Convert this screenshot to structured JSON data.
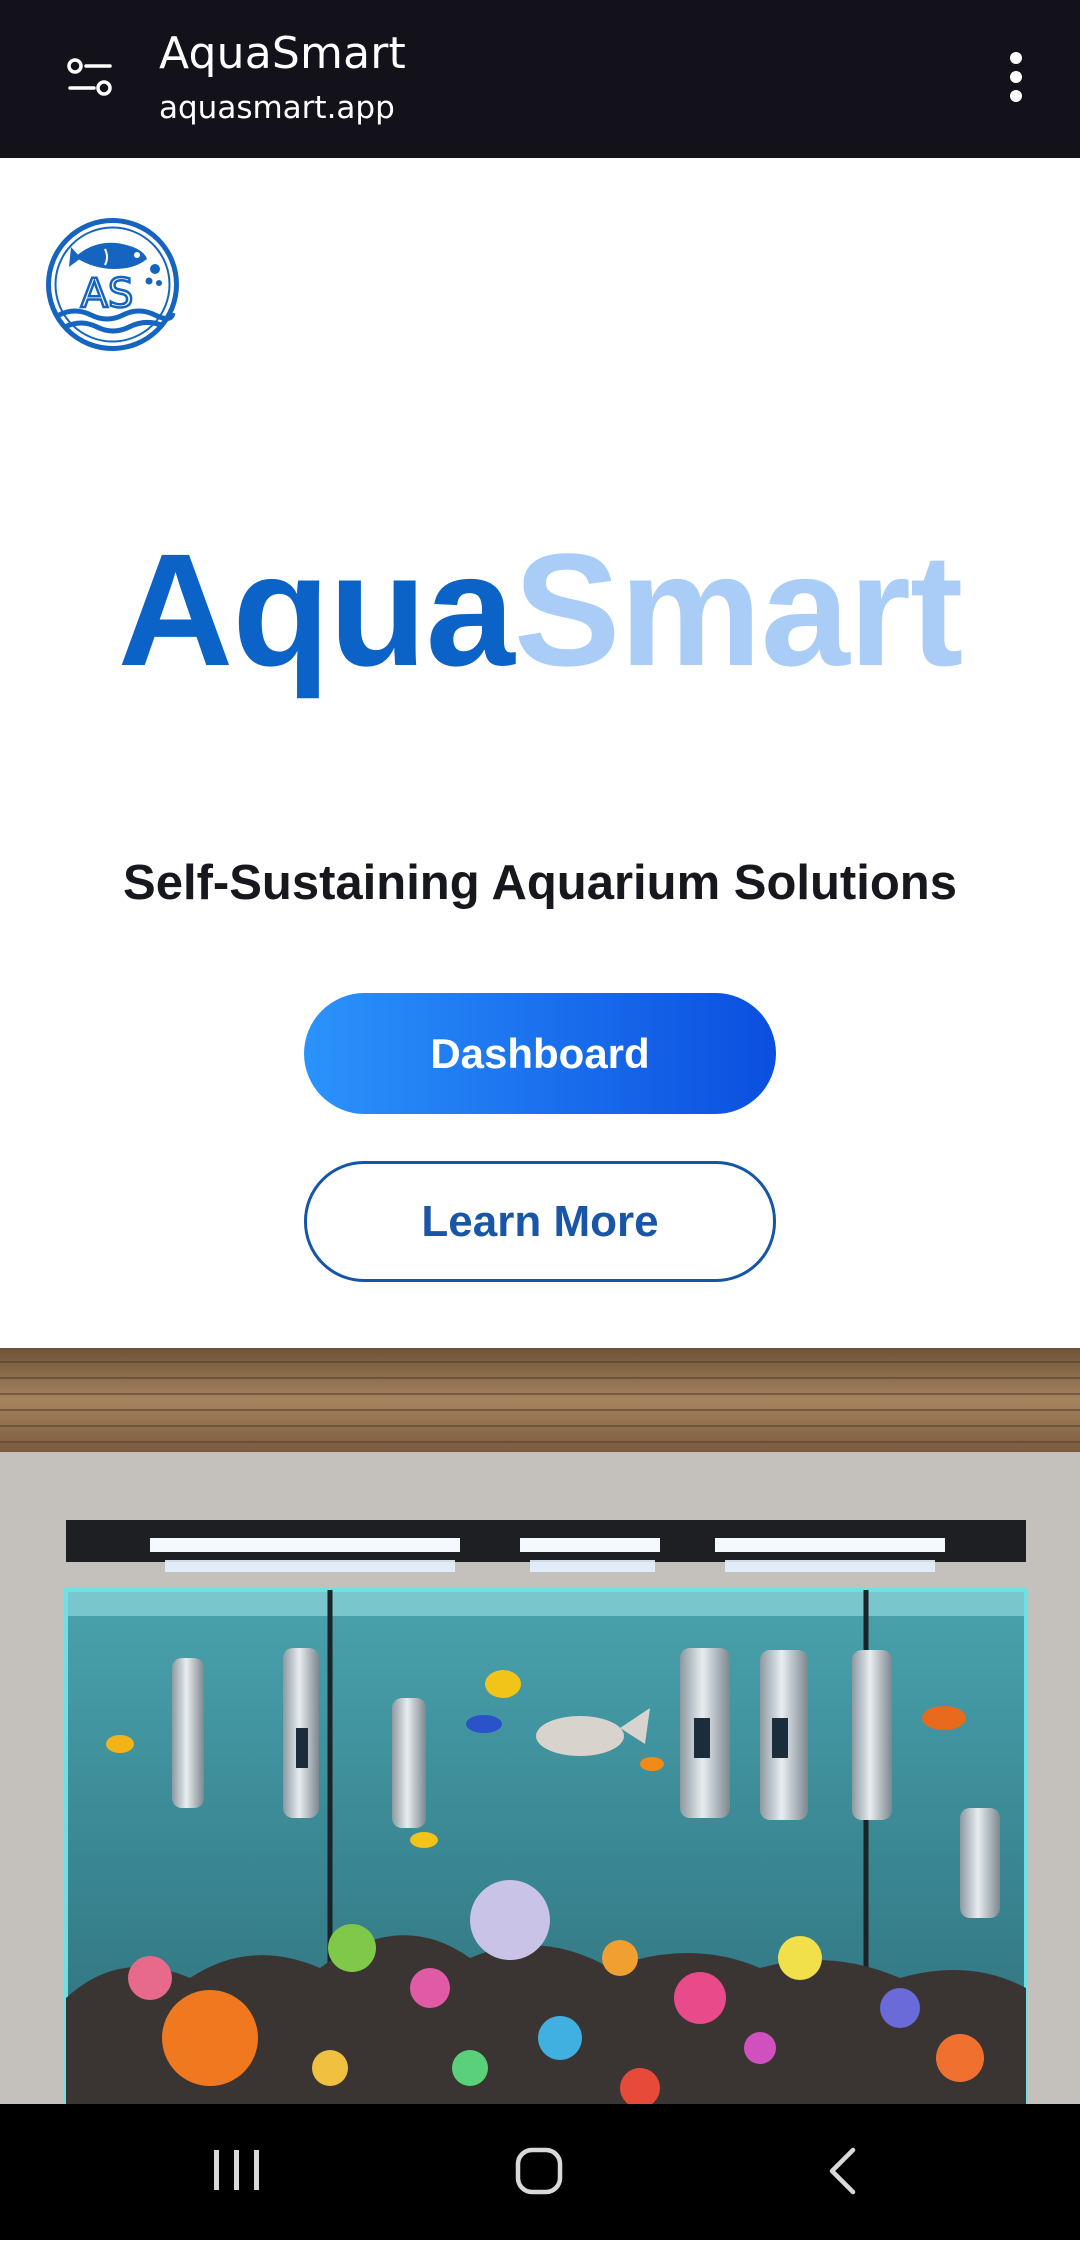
{
  "browser": {
    "site_title": "AquaSmart",
    "url": "aquasmart.app",
    "tune_icon": "tune-icon",
    "menu_icon": "more-vert-icon"
  },
  "logo": {
    "icon": "aquasmart-fish-logo",
    "text": "AS",
    "color": "#1565c0"
  },
  "hero_title": {
    "part1": "Aqua",
    "part2": "Smart",
    "color1": "#0b63c8",
    "color2": "#a9cdf6"
  },
  "tagline": "Self-Sustaining Aquarium Solutions",
  "buttons": {
    "primary": "Dashboard",
    "secondary": "Learn More"
  },
  "hero_image": {
    "icon": "aquarium-illustration"
  },
  "system_nav": {
    "recents_icon": "recents-icon",
    "home_icon": "home-icon",
    "back_icon": "back-icon"
  }
}
